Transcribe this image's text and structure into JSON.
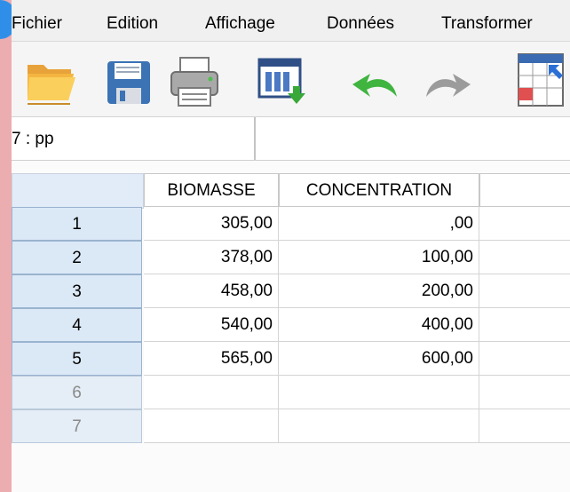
{
  "menu": [
    "Fichier",
    "Edition",
    "Affichage",
    "Données",
    "Transformer"
  ],
  "toolbar_icons": [
    "open-folder-icon",
    "save-icon",
    "print-icon",
    "dialog-recall-icon",
    "undo-icon",
    "redo-icon",
    "goto-case-icon"
  ],
  "cell_ref": "7 : pp",
  "cell_value": "",
  "columns": [
    "BIOMASSE",
    "CONCENTRATION"
  ],
  "rows": [
    {
      "n": "1",
      "biomasse": "305,00",
      "concentration": ",00"
    },
    {
      "n": "2",
      "biomasse": "378,00",
      "concentration": "100,00"
    },
    {
      "n": "3",
      "biomasse": "458,00",
      "concentration": "200,00"
    },
    {
      "n": "4",
      "biomasse": "540,00",
      "concentration": "400,00"
    },
    {
      "n": "5",
      "biomasse": "565,00",
      "concentration": "600,00"
    },
    {
      "n": "6",
      "biomasse": "",
      "concentration": ""
    },
    {
      "n": "7",
      "biomasse": "",
      "concentration": ""
    }
  ],
  "colors": {
    "accent": "#2f8fe8",
    "background": "#ecadb0",
    "row_header": "#dbe8f6"
  }
}
